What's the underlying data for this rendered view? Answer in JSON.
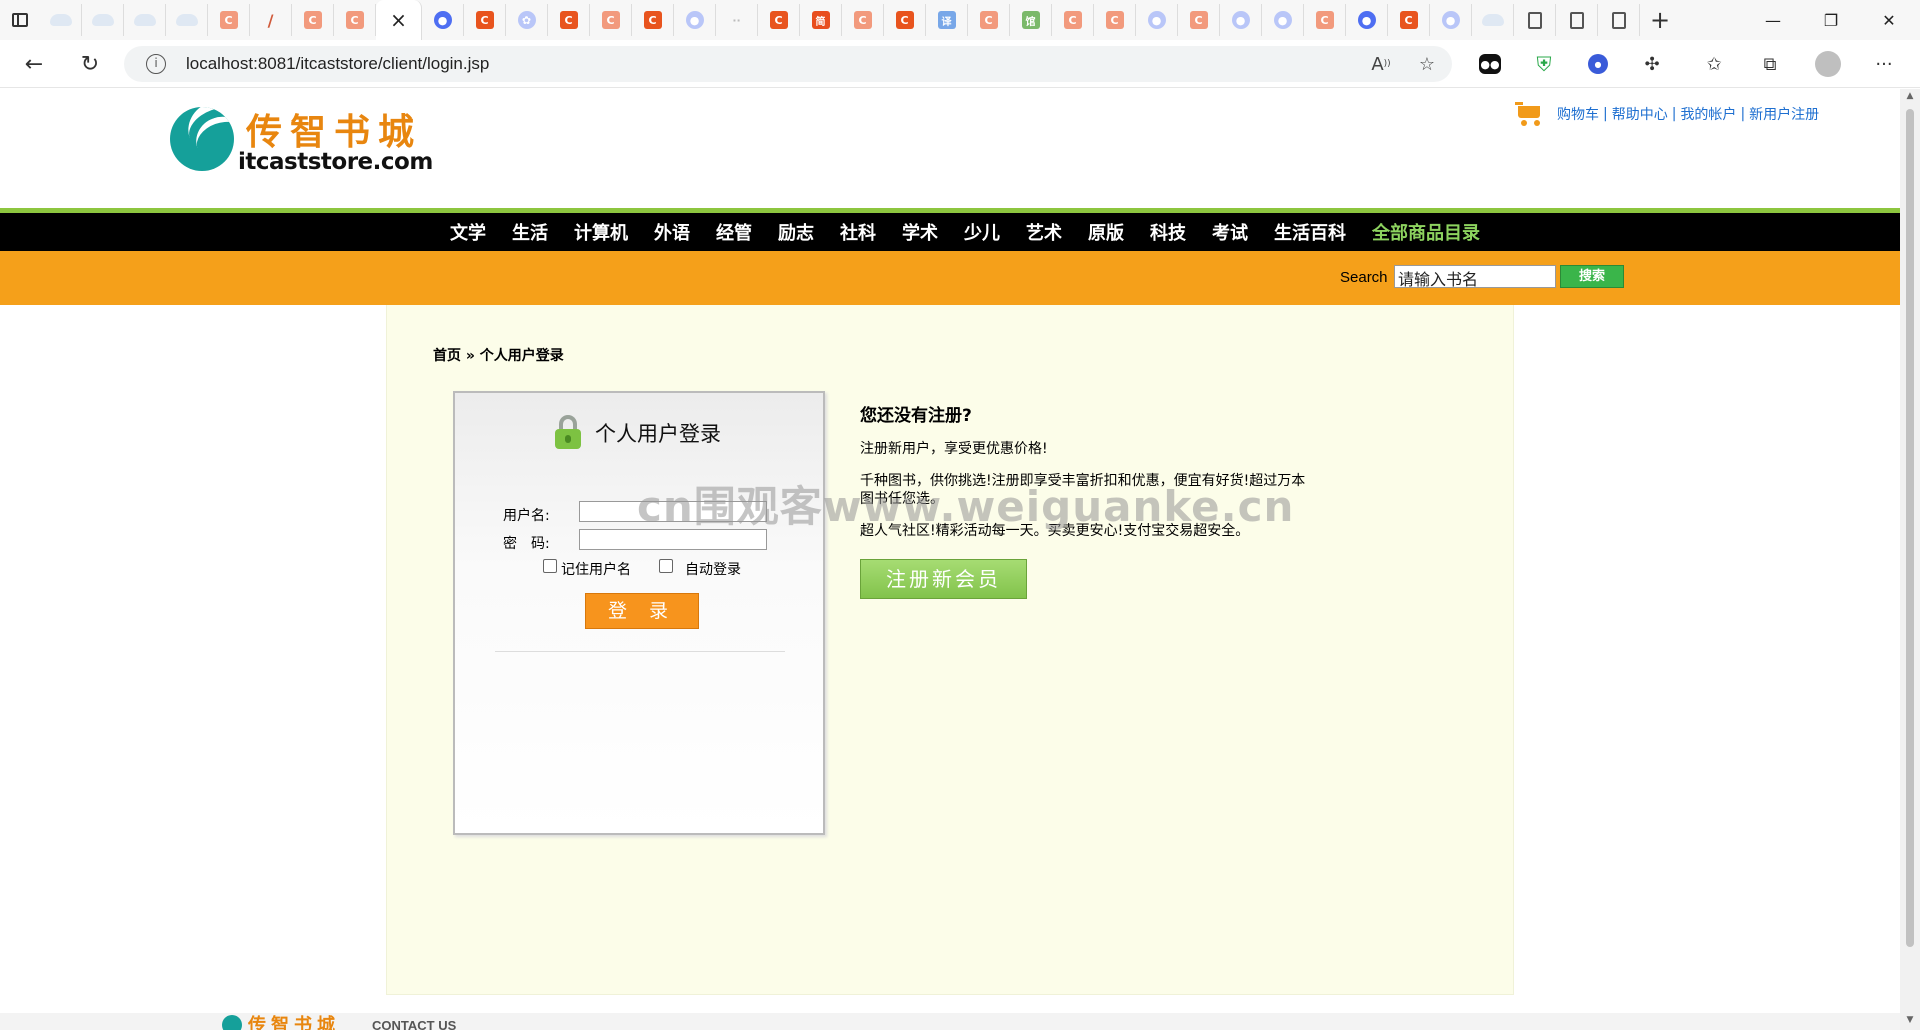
{
  "browser": {
    "tabs": [
      {
        "icon": "cloud-icon",
        "label": ""
      },
      {
        "icon": "cloud-icon",
        "label": ""
      },
      {
        "icon": "cloud-icon",
        "label": ""
      },
      {
        "icon": "cloud-icon",
        "label": ""
      },
      {
        "icon": "c-icon",
        "label": "C"
      },
      {
        "icon": "pen-icon",
        "label": "/"
      },
      {
        "icon": "c-icon",
        "label": "C"
      },
      {
        "icon": "c-icon",
        "label": "C"
      }
    ],
    "active_tab_close": "×",
    "url": "localhost:8081/itcaststore/client/login.jsp",
    "new_tab": "+",
    "minimize": "—",
    "maximize": "❐",
    "close": "✕"
  },
  "header": {
    "logo_cn": "传智书城",
    "logo_en": "itcaststore.com",
    "links": [
      "购物车",
      "帮助中心",
      "我的帐户",
      "新用户注册"
    ],
    "link_separator": "|"
  },
  "nav": {
    "categories": [
      "文学",
      "生活",
      "计算机",
      "外语",
      "经管",
      "励志",
      "社科",
      "学术",
      "少儿",
      "艺术",
      "原版",
      "科技",
      "考试",
      "生活百科"
    ],
    "all_label": "全部商品目录"
  },
  "search": {
    "label": "Search",
    "value": "请输入书名",
    "button": "搜索"
  },
  "breadcrumb": {
    "home": "首页",
    "sep": " » ",
    "current": "个人用户登录"
  },
  "login": {
    "title": "个人用户登录",
    "username_label": "用户名:",
    "password_label": "密　码:",
    "remember_label": "记住用户名",
    "auto_label": "自动登录",
    "submit": "登 录"
  },
  "register": {
    "title": "您还没有注册?",
    "lines": [
      "注册新用户，享受更优惠价格!",
      "千种图书，供你挑选!注册即享受丰富折扣和优惠，便宜有好货!超过万本图书任您选。",
      "超人气社区!精彩活动每一天。买卖更安心!支付宝交易超安全。"
    ],
    "button": "注册新会员"
  },
  "watermark": "cn围观客www.weiguanke.cn",
  "footer": {
    "logo_cn": "传智书城",
    "contact": "CONTACT US"
  },
  "colors": {
    "nav_bg": "#000000",
    "accent_orange": "#f5a01a",
    "accent_green": "#8dc63f",
    "link_blue": "#1e6fd0",
    "content_bg": "#fcfde9"
  }
}
